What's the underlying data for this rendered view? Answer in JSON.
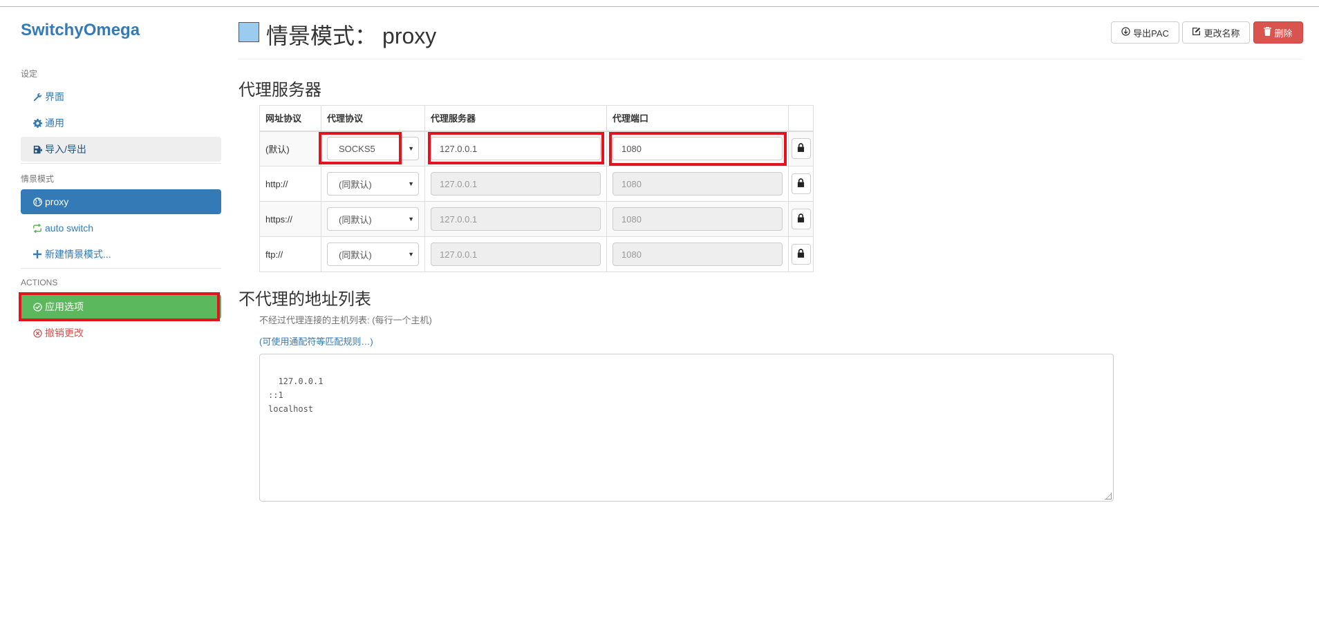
{
  "app": {
    "brand": "SwitchyOmega"
  },
  "sidebar": {
    "settings_header": "设定",
    "settings_items": [
      {
        "label": "界面",
        "icon": "wrench-icon"
      },
      {
        "label": "通用",
        "icon": "gear-icon"
      },
      {
        "label": "导入/导出",
        "icon": "import-export-icon"
      }
    ],
    "profiles_header": "情景模式",
    "profile_items": [
      {
        "label": "proxy",
        "icon": "globe-icon"
      },
      {
        "label": "auto switch",
        "icon": "refresh-icon"
      },
      {
        "label": "新建情景模式...",
        "icon": "plus-icon"
      }
    ],
    "actions_header": "ACTIONS",
    "action_items": [
      {
        "label": "应用选项",
        "icon": "check-circle-icon"
      },
      {
        "label": "撤销更改",
        "icon": "x-circle-icon"
      }
    ]
  },
  "header": {
    "title_prefix": "情景模式：",
    "profile_name": "proxy",
    "profile_color": "#99ccee",
    "buttons": {
      "export_pac": "导出PAC",
      "rename": "更改名称",
      "delete": "删除"
    }
  },
  "proxy_servers": {
    "title": "代理服务器",
    "columns": [
      "网址协议",
      "代理协议",
      "代理服务器",
      "代理端口"
    ],
    "rows": [
      {
        "scheme": "(默认)",
        "protocol": "SOCKS5",
        "server": "127.0.0.1",
        "port": "1080",
        "disabled": false
      },
      {
        "scheme": "http://",
        "protocol": "(同默认)",
        "server": "127.0.0.1",
        "port": "1080",
        "disabled": true
      },
      {
        "scheme": "https://",
        "protocol": "(同默认)",
        "server": "127.0.0.1",
        "port": "1080",
        "disabled": true
      },
      {
        "scheme": "ftp://",
        "protocol": "(同默认)",
        "server": "127.0.0.1",
        "port": "1080",
        "disabled": true
      }
    ]
  },
  "bypass": {
    "title": "不代理的地址列表",
    "help": "不经过代理连接的主机列表: (每行一个主机)",
    "link": "(可使用通配符等匹配规则…)",
    "content": "127.0.0.1\n::1\nlocalhost"
  },
  "colors": {
    "primary": "#337ab7",
    "success": "#5cb85c",
    "danger": "#d9534f",
    "highlight": "#e0141e"
  }
}
